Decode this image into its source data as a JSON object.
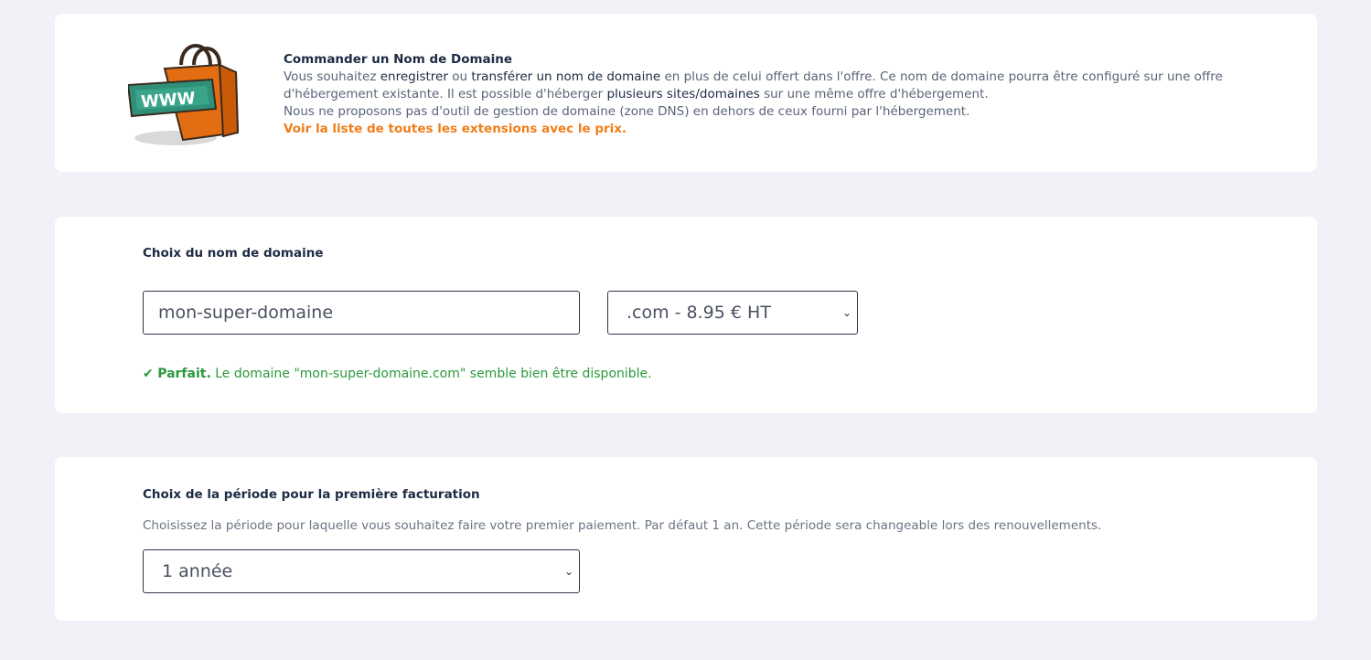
{
  "order": {
    "title": "Commander un Nom de Domaine",
    "line1_a": "Vous souhaitez ",
    "line1_b": "enregistrer",
    "line1_c": " ou ",
    "line1_d": "transférer un nom de domaine",
    "line1_e": " en plus de celui offert dans l'offre. Ce nom de domaine pourra être configuré sur une offre d'hébergement existante. Il est possible d'héberger ",
    "line1_f": "plusieurs sites/domaines",
    "line1_g": " sur une même offre d'hébergement.",
    "line2": "Nous ne proposons pas d'outil de gestion de domaine (zone DNS) en dehors de ceux fourni par l'hébergement.",
    "link": "Voir la liste de toutes les extensions avec le prix.",
    "bag_text": "WWW"
  },
  "domain": {
    "title": "Choix du nom de domaine",
    "input_value": "mon-super-domaine",
    "extension_selected": ".com - 8.95 € HT",
    "status_strong": "Parfait.",
    "status_text": " Le domaine \"mon-super-domaine.com\" semble bien être disponible."
  },
  "period": {
    "title": "Choix de la période pour la première facturation",
    "hint": "Choisissez la période pour laquelle vous souhaitez faire votre premier paiement. Par défaut 1 an. Cette période sera changeable lors des renouvellements.",
    "selected": "1 année"
  },
  "colors": {
    "accent": "#f07d18",
    "success": "#2a9a3c",
    "background": "#f1f2f7"
  }
}
